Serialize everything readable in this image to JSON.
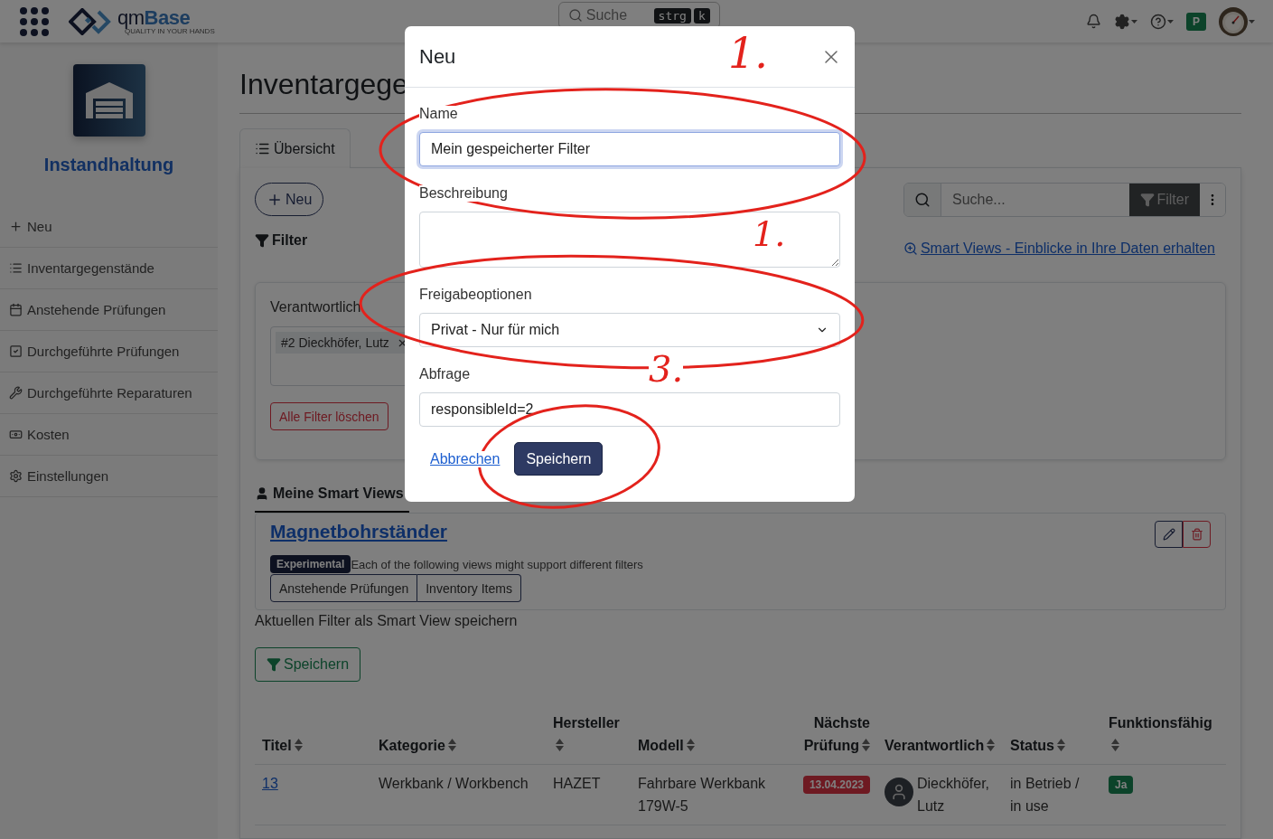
{
  "topbar": {
    "brand": {
      "prefix": "qm",
      "name": "Base",
      "tagline": "QUALITY IN YOUR HANDS"
    },
    "search": {
      "placeholder": "Suche",
      "shortcut": [
        "strg",
        "k"
      ]
    },
    "workspace_badge": "P"
  },
  "sidebar": {
    "title": "Instandhaltung",
    "items": [
      {
        "label": "Neu"
      },
      {
        "label": "Inventargegenstände"
      },
      {
        "label": "Anstehende Prüfungen"
      },
      {
        "label": "Durchgeführte Prüfungen"
      },
      {
        "label": "Durchgeführte Reparaturen"
      },
      {
        "label": "Kosten"
      },
      {
        "label": "Einstellungen"
      }
    ]
  },
  "page": {
    "title": "Inventargege",
    "tabs": [
      {
        "label": "Übersicht",
        "selected": true
      }
    ]
  },
  "toolbar": {
    "new_button": "Neu",
    "filter_heading": "Filter",
    "search": {
      "placeholder": "Suche..."
    },
    "filter_button": "Filter",
    "smart_views_link": "Smart Views - Einblicke in Ihre Daten erhalten"
  },
  "filter_panel": {
    "label": "Verantwortlich",
    "chips": [
      "#2 Dieckhöfer, Lutz"
    ],
    "clear_button": "Alle Filter löschen"
  },
  "smart_views": {
    "tab": "Meine Smart Views",
    "items": [
      {
        "title": "Magnetbohrständer",
        "badge": "Experimental",
        "note": "Each of the following views might support different filters",
        "views": [
          "Anstehende Prüfungen",
          "Inventory Items"
        ]
      }
    ],
    "save_hint": "Aktuellen Filter als Smart View speichern",
    "save_button": "Speichern"
  },
  "table": {
    "columns": [
      "Titel",
      "Kategorie",
      "Hersteller",
      "Modell",
      "Nächste Prüfung",
      "Verantwortlich",
      "Status",
      "Funktionsfähig"
    ],
    "rows": [
      {
        "title": "13",
        "category": "Werkbank / Workbench",
        "manufacturer": "HAZET",
        "model": "Fahrbare Werkbank 179W-5",
        "next_check": "13.04.2023",
        "responsible": "Dieckhöfer, Lutz",
        "status": "in Betrieb / in use",
        "functional": "Ja"
      }
    ]
  },
  "dialog": {
    "title": "Neu",
    "fields": [
      {
        "kind": "input",
        "label": "Name",
        "value": "Mein gespeicherter Filter",
        "focused": true
      },
      {
        "kind": "textarea",
        "label": "Beschreibung",
        "focused": false
      },
      {
        "kind": "select",
        "label": "Freigabeoptionen",
        "value": "Privat - Nur für mich",
        "focused": false
      },
      {
        "kind": "input",
        "label": "Abfrage",
        "value": "responsibleId=2",
        "focused": false
      }
    ],
    "cancel": "Abbrechen",
    "save": "Speichern"
  },
  "annotations": [
    "1.",
    "1.",
    "3."
  ]
}
